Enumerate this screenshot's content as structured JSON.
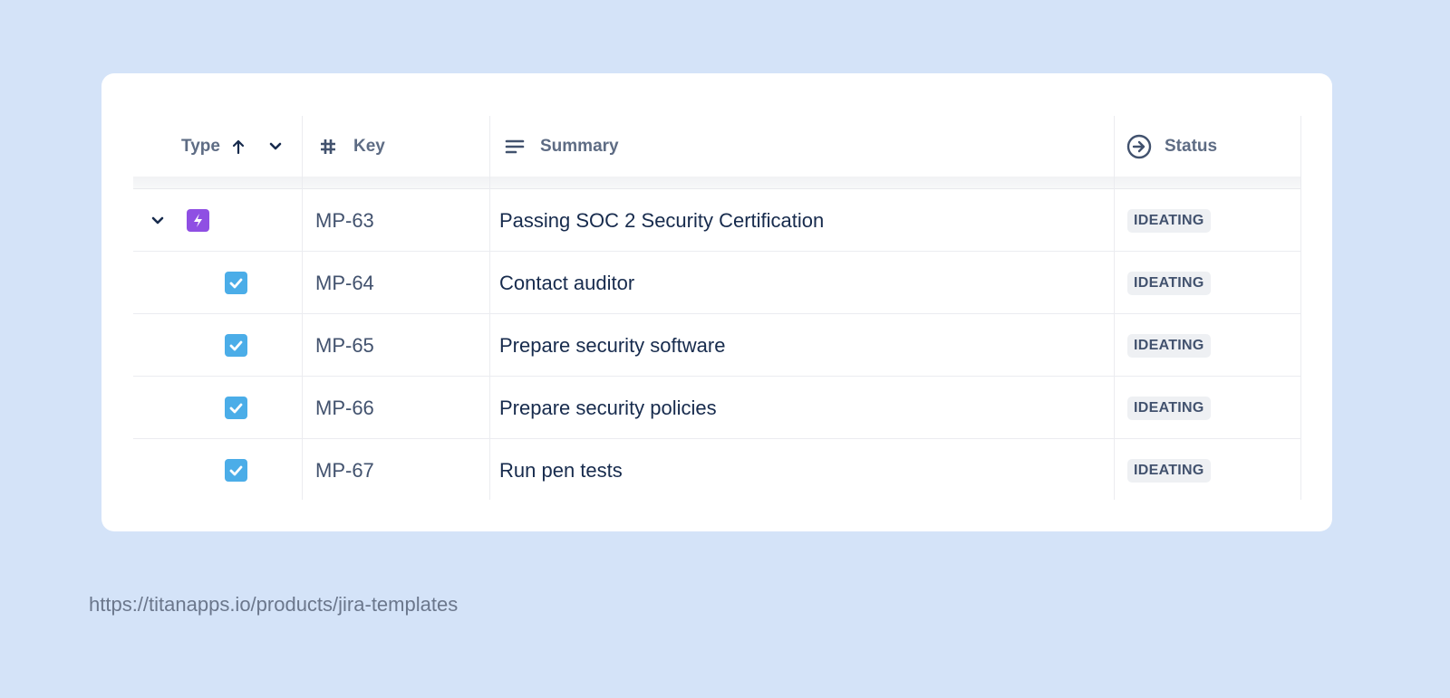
{
  "columns": {
    "type": "Type",
    "key": "Key",
    "summary": "Summary",
    "status": "Status"
  },
  "rows": [
    {
      "key": "MP-63",
      "summary": "Passing SOC 2 Security Certification",
      "status": "IDEATING",
      "type": "epic-icon"
    },
    {
      "key": "MP-64",
      "summary": "Contact auditor",
      "status": "IDEATING",
      "type": "task-icon"
    },
    {
      "key": "MP-65",
      "summary": "Prepare security software",
      "status": "IDEATING",
      "type": "task-icon"
    },
    {
      "key": "MP-66",
      "summary": "Prepare security policies",
      "status": "IDEATING",
      "type": "task-icon"
    },
    {
      "key": "MP-67",
      "summary": "Run pen tests",
      "status": "IDEATING",
      "type": "task-icon"
    }
  ],
  "footer_url": "https://titanapps.io/products/jira-templates",
  "colors": {
    "epic": "#8f4fe3",
    "task": "#4bade8",
    "background": "#d4e3f8"
  }
}
